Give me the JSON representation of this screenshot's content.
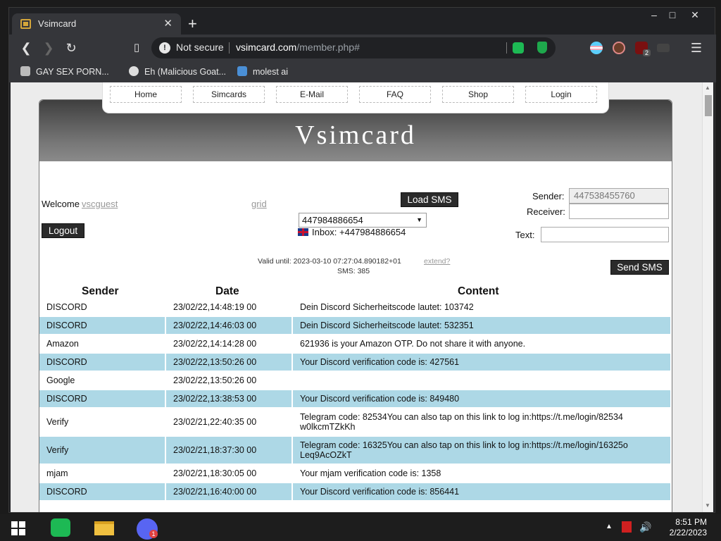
{
  "browser": {
    "tab_title": "Vsimcard",
    "new_tab_label": "+",
    "not_secure": "Not secure",
    "url_domain": "vsimcard.com",
    "url_path": "/member.php#",
    "bookmarks": [
      "GAY SEX PORN...",
      "Eh (Malicious Goat...",
      "molest ai"
    ],
    "extension_badge": "2"
  },
  "site": {
    "menu": [
      "Home",
      "Simcards",
      "E-Mail",
      "FAQ",
      "Shop",
      "Login"
    ],
    "brand": "Vsimcard",
    "welcome": "Welcome",
    "username": "vscguest",
    "grid_link": "grid",
    "selected_number": "447984886654",
    "load_sms": "Load SMS",
    "logout": "Logout",
    "inbox": "Inbox: +447984886654",
    "valid_until": "Valid until: 2023-03-10 07:27:04.890182+01",
    "extend": "extend?",
    "sms_count": "SMS: 385",
    "sender_label": "Sender:",
    "sender_value": "447538455760",
    "receiver_label": "Receiver:",
    "text_label": "Text:",
    "send_sms": "Send SMS"
  },
  "table": {
    "headers": [
      "Sender",
      "Date",
      "Content"
    ],
    "rows": [
      {
        "sender": "DISCORD",
        "date": "23/02/22,14:48:19 00",
        "content": "Dein Discord Sicherheitscode lautet: 103742"
      },
      {
        "sender": "DISCORD",
        "date": "23/02/22,14:46:03 00",
        "content": "Dein Discord Sicherheitscode lautet: 532351"
      },
      {
        "sender": "Amazon",
        "date": "23/02/22,14:14:28 00",
        "content": "621936 is your Amazon OTP. Do not share it with anyone."
      },
      {
        "sender": "DISCORD",
        "date": "23/02/22,13:50:26 00",
        "content": "Your Discord verification code is: 427561"
      },
      {
        "sender": "Google",
        "date": "23/02/22,13:50:26 00",
        "content": ""
      },
      {
        "sender": "DISCORD",
        "date": "23/02/22,13:38:53 00",
        "content": "Your Discord verification code is: 849480"
      },
      {
        "sender": "Verify",
        "date": "23/02/21,22:40:35 00",
        "content": "Telegram code: 82534You can also tap on this link to log in:https://t.me/login/82534 w0lkcmTZkKh"
      },
      {
        "sender": "Verify",
        "date": "23/02/21,18:37:30 00",
        "content": "Telegram code: 16325You can also tap on this link to log in:https://t.me/login/16325o Leq9AcOZkT"
      },
      {
        "sender": "mjam",
        "date": "23/02/21,18:30:05 00",
        "content": "Your mjam verification code is: 1358"
      },
      {
        "sender": "DISCORD",
        "date": "23/02/21,16:40:00 00",
        "content": "Your Discord verification code is: 856441"
      }
    ]
  },
  "taskbar": {
    "time": "8:51 PM",
    "date": "2/22/2023",
    "discord_badge": "1"
  },
  "colors": {
    "row_alt": "#add8e6",
    "button_dark": "#2b2b2b"
  }
}
